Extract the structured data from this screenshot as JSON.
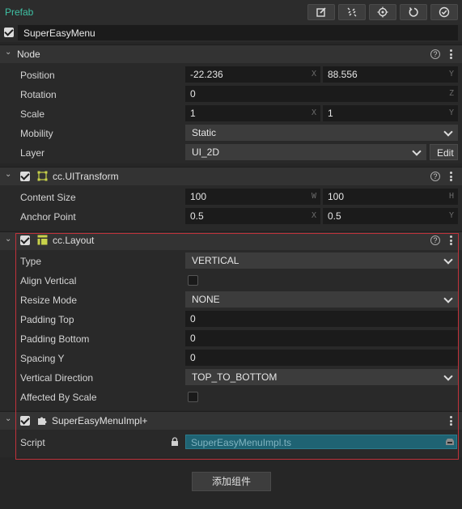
{
  "prefab": {
    "title": "Prefab",
    "toolbar_icons": [
      "edit-icon",
      "unlink-icon",
      "locate-icon",
      "revert-icon",
      "apply-icon"
    ]
  },
  "node_name": "SuperEasyMenu",
  "node": {
    "title": "Node",
    "position": {
      "label": "Position",
      "x": "-22.236",
      "y": "88.556",
      "x_axis": "X",
      "y_axis": "Y"
    },
    "rotation": {
      "label": "Rotation",
      "value": "0",
      "axis": "Z"
    },
    "scale": {
      "label": "Scale",
      "x": "1",
      "y": "1",
      "x_axis": "X",
      "y_axis": "Y"
    },
    "mobility": {
      "label": "Mobility",
      "value": "Static"
    },
    "layer": {
      "label": "Layer",
      "value": "UI_2D",
      "edit": "Edit"
    }
  },
  "ui_transform": {
    "title": "cc.UITransform",
    "content_size": {
      "label": "Content Size",
      "w": "100",
      "h": "100",
      "w_axis": "W",
      "h_axis": "H"
    },
    "anchor_point": {
      "label": "Anchor Point",
      "x": "0.5",
      "y": "0.5",
      "x_axis": "X",
      "y_axis": "Y"
    }
  },
  "layout": {
    "title": "cc.Layout",
    "type": {
      "label": "Type",
      "value": "VERTICAL"
    },
    "align_vertical": {
      "label": "Align Vertical"
    },
    "resize_mode": {
      "label": "Resize Mode",
      "value": "NONE"
    },
    "padding_top": {
      "label": "Padding Top",
      "value": "0"
    },
    "padding_bottom": {
      "label": "Padding Bottom",
      "value": "0"
    },
    "spacing_y": {
      "label": "Spacing Y",
      "value": "0"
    },
    "vertical_direction": {
      "label": "Vertical Direction",
      "value": "TOP_TO_BOTTOM"
    },
    "affected_by_scale": {
      "label": "Affected By Scale"
    }
  },
  "script_comp": {
    "title": "SuperEasyMenuImpl+",
    "script": {
      "label": "Script",
      "value": "SuperEasyMenuImpl.ts"
    }
  },
  "add_component": "添加组件",
  "colors": {
    "accent": "#3fc1a4",
    "highlight": "#c0323b",
    "script_bg": "#1f6373"
  }
}
